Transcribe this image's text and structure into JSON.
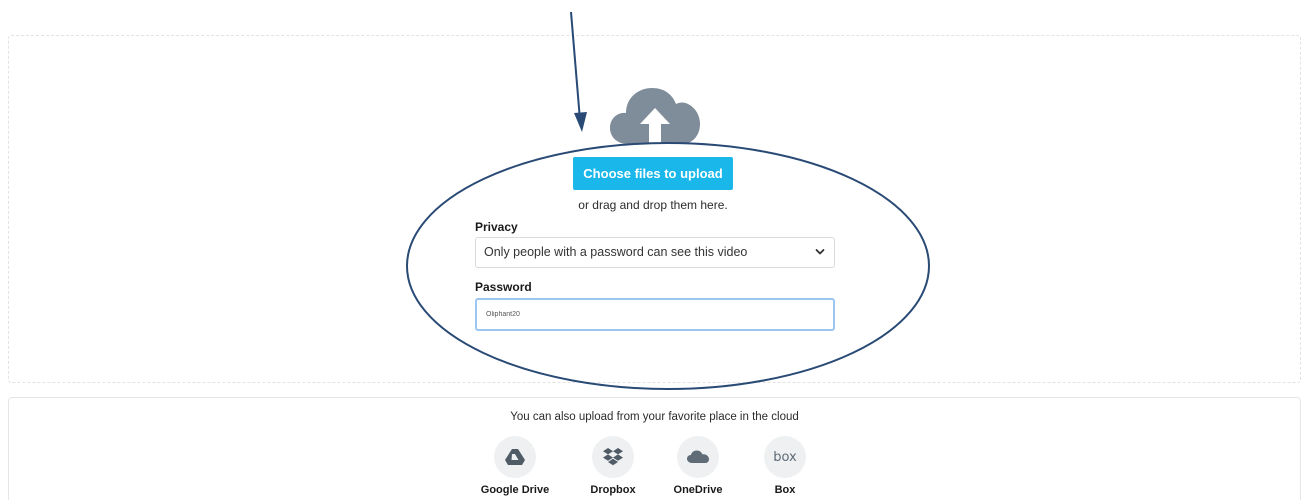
{
  "upload": {
    "choose_button_label": "Choose files to upload",
    "drag_drop_text": "or drag and drop them here.",
    "privacy": {
      "label": "Privacy",
      "selected": "Only people with a password can see this video"
    },
    "password": {
      "label": "Password",
      "value": "Oliphant20"
    }
  },
  "cloud_sources": {
    "title": "You can also upload from your favorite place in the cloud",
    "providers": [
      {
        "label": "Google Drive",
        "icon": "google-drive-icon"
      },
      {
        "label": "Dropbox",
        "icon": "dropbox-icon"
      },
      {
        "label": "OneDrive",
        "icon": "onedrive-icon"
      },
      {
        "label": "Box",
        "icon": "box-icon",
        "wordmark": "box"
      }
    ]
  },
  "colors": {
    "accent_button": "#1ab7ea",
    "icon_gray": "#7f8c99",
    "annotation_navy": "#2a4a76",
    "input_focus_border": "#9cc6f2"
  }
}
